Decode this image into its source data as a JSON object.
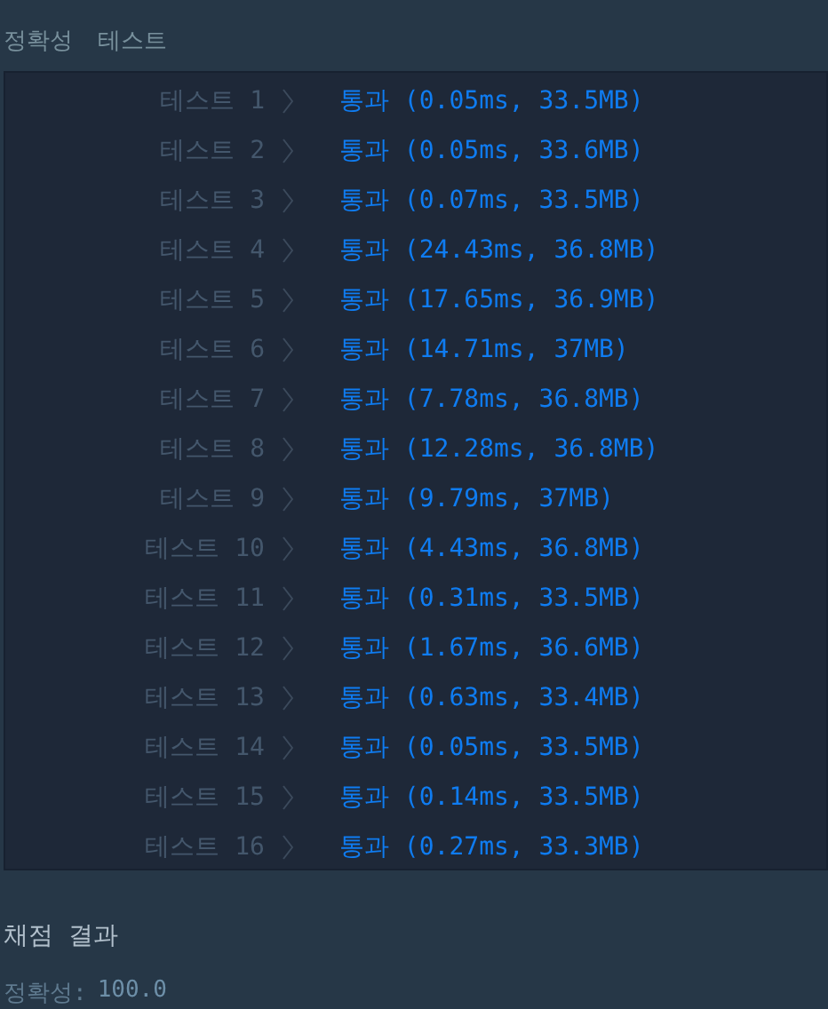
{
  "heading": {
    "title": "정확성",
    "subtitle": "테스트"
  },
  "tests": [
    {
      "label": "테스트 1",
      "passed": true,
      "result": "통과 (0.05ms, 33.5MB)"
    },
    {
      "label": "테스트 2",
      "passed": true,
      "result": "통과 (0.05ms, 33.6MB)"
    },
    {
      "label": "테스트 3",
      "passed": true,
      "result": "통과 (0.07ms, 33.5MB)"
    },
    {
      "label": "테스트 4",
      "passed": true,
      "result": "통과 (24.43ms, 36.8MB)"
    },
    {
      "label": "테스트 5",
      "passed": true,
      "result": "통과 (17.65ms, 36.9MB)"
    },
    {
      "label": "테스트 6",
      "passed": true,
      "result": "통과 (14.71ms, 37MB)"
    },
    {
      "label": "테스트 7",
      "passed": true,
      "result": "통과 (7.78ms, 36.8MB)"
    },
    {
      "label": "테스트 8",
      "passed": true,
      "result": "통과 (12.28ms, 36.8MB)"
    },
    {
      "label": "테스트 9",
      "passed": true,
      "result": "통과 (9.79ms, 37MB)"
    },
    {
      "label": "테스트 10",
      "passed": true,
      "result": "통과 (4.43ms, 36.8MB)"
    },
    {
      "label": "테스트 11",
      "passed": true,
      "result": "통과 (0.31ms, 33.5MB)"
    },
    {
      "label": "테스트 12",
      "passed": true,
      "result": "통과 (1.67ms, 36.6MB)"
    },
    {
      "label": "테스트 13",
      "passed": true,
      "result": "통과 (0.63ms, 33.4MB)"
    },
    {
      "label": "테스트 14",
      "passed": true,
      "result": "통과 (0.05ms, 33.5MB)"
    },
    {
      "label": "테스트 15",
      "passed": true,
      "result": "통과 (0.14ms, 33.5MB)"
    },
    {
      "label": "테스트 16",
      "passed": true,
      "result": "통과 (0.27ms, 33.3MB)"
    }
  ],
  "summary": {
    "title": "채점 결과",
    "score_label": "정확성:",
    "score": "100.0"
  }
}
